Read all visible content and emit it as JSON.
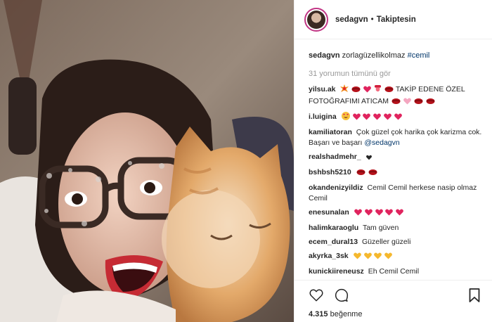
{
  "post": {
    "username": "sedagvn",
    "separator": "•",
    "follow_label": "Takiptesin",
    "caption": {
      "user": "sedagvn",
      "text": "zorlagüzellikolmaz",
      "hashtag": "#cemil"
    },
    "view_all_comments": "31 yorumun tümünü gör",
    "comments": [
      {
        "user": "yilsu.ak",
        "text": "TAKİP EDENE ÖZEL FOTOĞRAFIMI ATICAM"
      },
      {
        "user": "i.luigina",
        "text": ""
      },
      {
        "user": "kamiliatoran",
        "text": "Çok güzel çok harika çok karizma cok. Başarı ve başarı",
        "mention": "@sedagvn"
      },
      {
        "user": "realshadmehr_",
        "text": ""
      },
      {
        "user": "bshbsh5210",
        "text": ""
      },
      {
        "user": "okandenizyildiz",
        "text": "Cemil Cemil herkese nasip olmaz Cemil"
      },
      {
        "user": "enesunalan",
        "text": ""
      },
      {
        "user": "halimkaraoglu",
        "text": "Tam güven"
      },
      {
        "user": "ecem_dural13",
        "text": "Güzeller güzeli"
      },
      {
        "user": "akyrka_3sk",
        "text": ""
      },
      {
        "user": "kunickiireneusz",
        "text": "Eh Cemil Cemil"
      }
    ],
    "likes_count": "4.315",
    "likes_label": "beğenme",
    "colors": {
      "accent_link": "#003569",
      "heart": "#ed4956",
      "muted": "#999999"
    }
  }
}
